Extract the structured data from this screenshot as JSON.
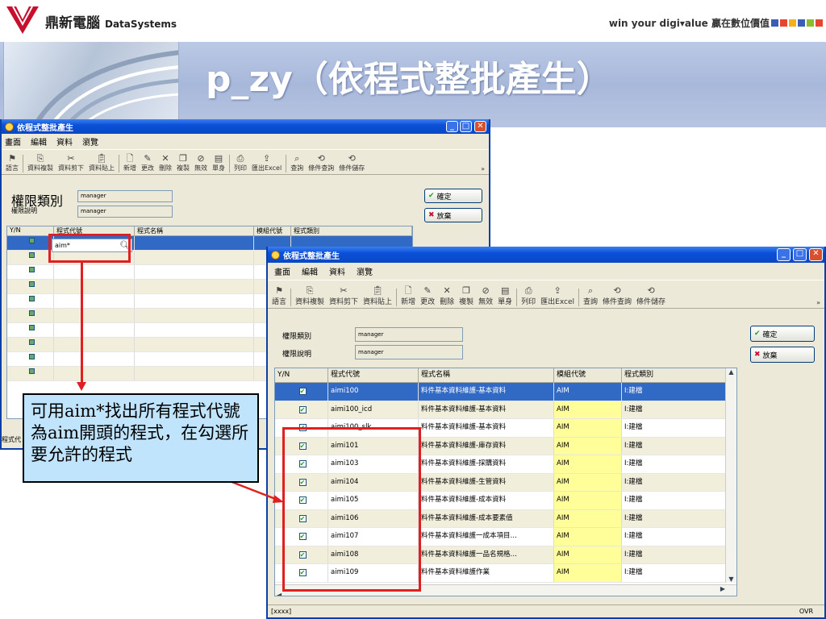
{
  "slide": {
    "brand_name": "鼎新電腦",
    "brand_sub": "DataSystems",
    "slogan": "win your digi▾alue 贏在數位價值",
    "title": "p_zy（依程式整批產生）",
    "square_colors": [
      "#3a5db7",
      "#e6452f",
      "#f2b01c",
      "#3a5db7",
      "#8bbb2e",
      "#e6452f"
    ]
  },
  "window_back": {
    "title": "依程式整批產生",
    "menu": [
      "畫面",
      "編輯",
      "資料",
      "瀏覽"
    ],
    "toolbar": [
      {
        "icon": "flag-icon",
        "label": "語言"
      },
      {
        "icon": "copy-icon",
        "label": "資料複製"
      },
      {
        "icon": "cut-icon",
        "label": "資料剪下"
      },
      {
        "icon": "paste-icon",
        "label": "資料貼上"
      },
      {
        "icon": "new-icon",
        "label": "新增"
      },
      {
        "icon": "edit-icon",
        "label": "更改"
      },
      {
        "icon": "delete-icon",
        "label": "刪除"
      },
      {
        "icon": "duplicate-icon",
        "label": "複製"
      },
      {
        "icon": "invalid-icon",
        "label": "無效"
      },
      {
        "icon": "single-icon",
        "label": "單身"
      },
      {
        "icon": "print-icon",
        "label": "列印"
      },
      {
        "icon": "export-icon",
        "label": "匯出Excel"
      },
      {
        "icon": "query-icon",
        "label": "查詢"
      },
      {
        "icon": "cond-query-icon",
        "label": "條件查詢"
      },
      {
        "icon": "cond-save-icon",
        "label": "條件儲存"
      }
    ],
    "more": "»",
    "perm_class_label": "權限類別",
    "perm_class_value": "manager",
    "perm_desc_label": "權限說明",
    "perm_desc_value": "manager",
    "ok": "確定",
    "cancel": "放棄",
    "columns": [
      "Y/N",
      "程式代號",
      "程式名稱",
      "模組代號",
      "程式類別"
    ],
    "search_value": "aim*",
    "status_left": "程式代"
  },
  "window_front": {
    "title": "依程式整批產生",
    "menu": [
      "畫面",
      "編輯",
      "資料",
      "瀏覽"
    ],
    "toolbar": [
      {
        "icon": "flag-icon",
        "label": "語言"
      },
      {
        "icon": "copy-icon",
        "label": "資料複製"
      },
      {
        "icon": "cut-icon",
        "label": "資料剪下"
      },
      {
        "icon": "paste-icon",
        "label": "資料貼上"
      },
      {
        "icon": "new-icon",
        "label": "新增"
      },
      {
        "icon": "edit-icon",
        "label": "更改"
      },
      {
        "icon": "delete-icon",
        "label": "刪除"
      },
      {
        "icon": "duplicate-icon",
        "label": "複製"
      },
      {
        "icon": "invalid-icon",
        "label": "無效"
      },
      {
        "icon": "single-icon",
        "label": "單身"
      },
      {
        "icon": "print-icon",
        "label": "列印"
      },
      {
        "icon": "export-icon",
        "label": "匯出Excel"
      },
      {
        "icon": "query-icon",
        "label": "查詢"
      },
      {
        "icon": "cond-query-icon",
        "label": "條件查詢"
      },
      {
        "icon": "cond-save-icon",
        "label": "條件儲存"
      }
    ],
    "more": "»",
    "perm_class_label": "權限類別",
    "perm_class_value": "manager",
    "perm_desc_label": "權限說明",
    "perm_desc_value": "manager",
    "ok": "確定",
    "cancel": "放棄",
    "columns": [
      "Y/N",
      "程式代號",
      "程式名稱",
      "模組代號",
      "程式類別"
    ],
    "rows": [
      {
        "code": "aimi100",
        "name": "料件基本資料維護-基本資料",
        "module": "AIM",
        "type": "I:建檔"
      },
      {
        "code": "aimi100_icd",
        "name": "料件基本資料維護-基本資料",
        "module": "AIM",
        "type": "I:建檔"
      },
      {
        "code": "aimi100_slk",
        "name": "料件基本資料維護-基本資料",
        "module": "AIM",
        "type": "I:建檔"
      },
      {
        "code": "aimi101",
        "name": "料件基本資料維護-庫存資料",
        "module": "AIM",
        "type": "I:建檔"
      },
      {
        "code": "aimi103",
        "name": "料件基本資料維護-採購資料",
        "module": "AIM",
        "type": "I:建檔"
      },
      {
        "code": "aimi104",
        "name": "料件基本資料維護-生管資料",
        "module": "AIM",
        "type": "I:建檔"
      },
      {
        "code": "aimi105",
        "name": "料件基本資料維護-成本資料",
        "module": "AIM",
        "type": "I:建檔"
      },
      {
        "code": "aimi106",
        "name": "料件基本資料維護-成本要素值",
        "module": "AIM",
        "type": "I:建檔"
      },
      {
        "code": "aimi107",
        "name": "料件基本資料維護一成本項目…",
        "module": "AIM",
        "type": "I:建檔"
      },
      {
        "code": "aimi108",
        "name": "料件基本資料維護一品名規格…",
        "module": "AIM",
        "type": "I:建檔"
      },
      {
        "code": "aimi109",
        "name": "料件基本資料維護作業",
        "module": "AIM",
        "type": "I:建檔"
      }
    ],
    "status_left": "[xxxx]",
    "status_right": "OVR"
  },
  "annotation": "可用aim*找出所有程式代號為aim開頭的程式，在勾選所要允許的程式",
  "colors": {
    "highlight_box": "#e02020",
    "arrow": "#e02020",
    "note_bg": "#bfe4fb"
  }
}
